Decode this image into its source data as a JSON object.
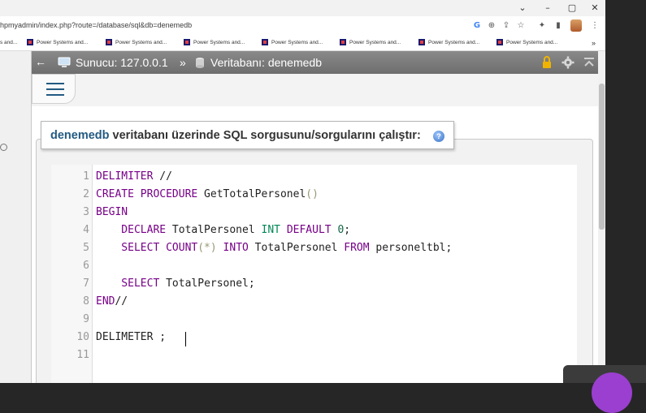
{
  "browser": {
    "window_controls": [
      "⌄",
      "–",
      "▢",
      "✕"
    ],
    "url": "hpmyadmin/index.php?route=/database/sql&db=denemedb",
    "bookmark_first": "s and...",
    "bookmarks": [
      "Power Systems and...",
      "Power Systems and...",
      "Power Systems and...",
      "Power Systems and...",
      "Power Systems and...",
      "Power Systems and...",
      "Power Systems and...",
      "Power Systems and..."
    ],
    "more_bookmarks": "»",
    "addr_icons": [
      "G",
      "⊕",
      "⇪",
      "☆",
      "✦",
      "▮",
      "⋮"
    ]
  },
  "serverbar": {
    "server_label": "Sunucu: 127.0.0.1",
    "separator": "»",
    "database_label": "Veritabanı: denemedb"
  },
  "legend": {
    "database_name": "denemedb",
    "text": " veritabanı üzerinde SQL sorgusunu/sorgularını çalıştır:"
  },
  "editor": {
    "line_numbers": [
      "1",
      "2",
      "3",
      "4",
      "5",
      "6",
      "7",
      "8",
      "9",
      "10",
      "11"
    ],
    "lines": [
      [
        {
          "t": "DELIMITER",
          "c": "kw"
        },
        {
          "t": " //",
          "c": ""
        }
      ],
      [
        {
          "t": "CREATE PROCEDURE",
          "c": "kw"
        },
        {
          "t": " GetTotalPersonel",
          "c": ""
        },
        {
          "t": "()",
          "c": "br"
        }
      ],
      [
        {
          "t": "BEGIN",
          "c": "kw"
        }
      ],
      [
        {
          "t": "    DECLARE",
          "c": "kw"
        },
        {
          "t": " TotalPersonel ",
          "c": ""
        },
        {
          "t": "INT",
          "c": "ty"
        },
        {
          "t": " ",
          "c": ""
        },
        {
          "t": "DEFAULT",
          "c": "kw"
        },
        {
          "t": " ",
          "c": ""
        },
        {
          "t": "0",
          "c": "nm"
        },
        {
          "t": ";",
          "c": ""
        }
      ],
      [
        {
          "t": "    SELECT COUNT",
          "c": "kw"
        },
        {
          "t": "(*)",
          "c": "br"
        },
        {
          "t": " ",
          "c": ""
        },
        {
          "t": "INTO",
          "c": "kw"
        },
        {
          "t": " TotalPersonel ",
          "c": ""
        },
        {
          "t": "FROM",
          "c": "kw"
        },
        {
          "t": " personeltbl;",
          "c": ""
        }
      ],
      [],
      [
        {
          "t": "    SELECT",
          "c": "kw"
        },
        {
          "t": " TotalPersonel;",
          "c": ""
        }
      ],
      [
        {
          "t": "END",
          "c": "kw"
        },
        {
          "t": "//",
          "c": ""
        }
      ],
      [],
      [
        {
          "t": "DELIMETER ;",
          "c": ""
        }
      ],
      []
    ]
  },
  "colors": {
    "serverbar": "#7b7b7b",
    "keyword": "#770088",
    "type": "#008855",
    "link": "#235a81"
  }
}
